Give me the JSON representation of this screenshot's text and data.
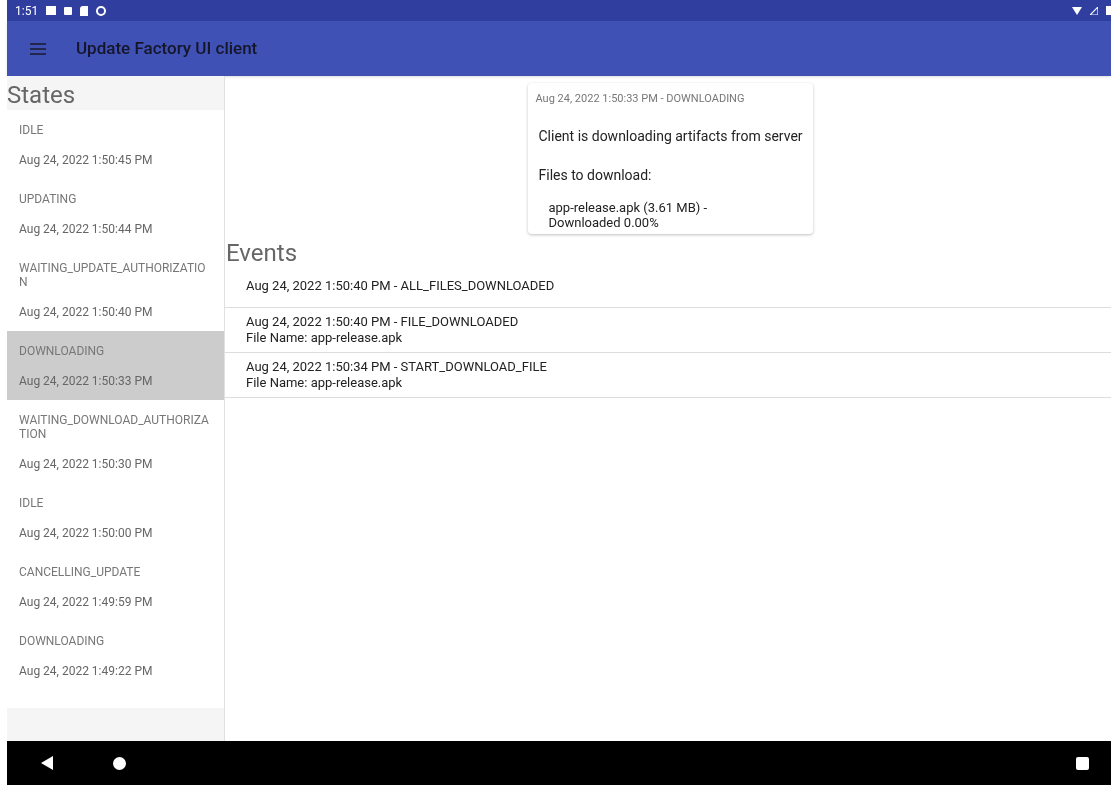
{
  "status_bar": {
    "time": "1:51"
  },
  "app_bar": {
    "title": "Update Factory UI client"
  },
  "states": {
    "title": "States",
    "items": [
      {
        "name": "IDLE",
        "time": "Aug 24, 2022 1:50:45 PM",
        "selected": false
      },
      {
        "name": "UPDATING",
        "time": "Aug 24, 2022 1:50:44 PM",
        "selected": false
      },
      {
        "name": "WAITING_UPDATE_AUTHORIZATION",
        "time": "Aug 24, 2022 1:50:40 PM",
        "selected": false
      },
      {
        "name": "DOWNLOADING",
        "time": "Aug 24, 2022 1:50:33 PM",
        "selected": true
      },
      {
        "name": "WAITING_DOWNLOAD_AUTHORIZATION",
        "time": "Aug 24, 2022 1:50:30 PM",
        "selected": false
      },
      {
        "name": "IDLE",
        "time": "Aug 24, 2022 1:50:00 PM",
        "selected": false
      },
      {
        "name": "CANCELLING_UPDATE",
        "time": "Aug 24, 2022 1:49:59 PM",
        "selected": false
      },
      {
        "name": "DOWNLOADING",
        "time": "Aug 24, 2022 1:49:22 PM",
        "selected": false
      }
    ]
  },
  "detail_card": {
    "header": "Aug 24, 2022 1:50:33 PM - DOWNLOADING",
    "message": "Client is downloading artifacts from server",
    "files_label": "Files to download:",
    "files": [
      "app-release.apk (3.61 MB) - Downloaded 0.00%"
    ]
  },
  "events": {
    "title": "Events",
    "items": [
      {
        "title": "Aug 24, 2022 1:50:40 PM - ALL_FILES_DOWNLOADED"
      },
      {
        "title": "Aug 24, 2022 1:50:40 PM - FILE_DOWNLOADED",
        "detail": "File Name: app-release.apk"
      },
      {
        "title": "Aug 24, 2022 1:50:34 PM - START_DOWNLOAD_FILE",
        "detail": "File Name: app-release.apk"
      }
    ]
  }
}
